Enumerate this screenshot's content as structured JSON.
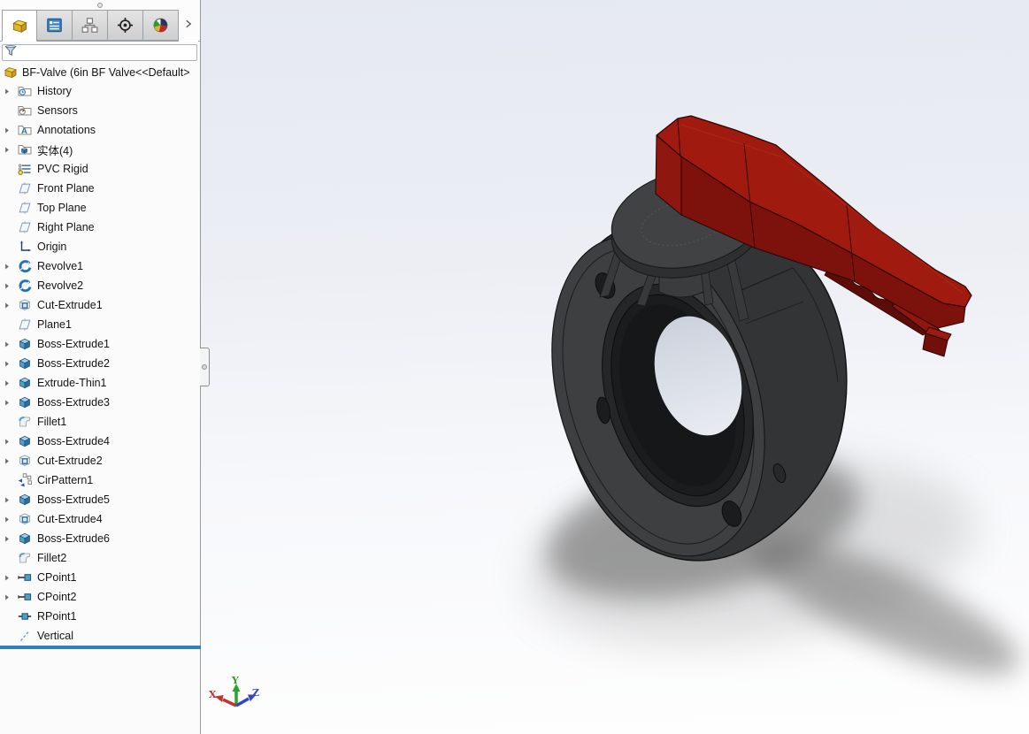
{
  "panel": {
    "tabs": [
      {
        "name": "featuremanager-design-tree",
        "icon": "part-icon",
        "active": true
      },
      {
        "name": "propertymanager",
        "icon": "property-manager-icon",
        "active": false
      },
      {
        "name": "configurationmanager",
        "icon": "configuration-manager-icon",
        "active": false
      },
      {
        "name": "dimxpertmanager",
        "icon": "dimxpert-manager-icon",
        "active": false
      },
      {
        "name": "displaymanager",
        "icon": "display-manager-icon",
        "active": false
      }
    ],
    "tab_overflow_icon": "chevron-right-icon",
    "filter": {
      "value": "",
      "placeholder": "",
      "icon": "filter-funnel-icon"
    },
    "tree": {
      "root": {
        "label": "BF-Valve (6in BF Valve<<Default>",
        "icon": "part-icon"
      },
      "items": [
        {
          "label": "History",
          "icon": "history-folder-icon",
          "expandable": true
        },
        {
          "label": "Sensors",
          "icon": "sensors-folder-icon",
          "expandable": false
        },
        {
          "label": "Annotations",
          "icon": "annotations-folder-icon",
          "expandable": true
        },
        {
          "label": "实体(4)",
          "icon": "solids-folder-icon",
          "expandable": true
        },
        {
          "label": "PVC Rigid",
          "icon": "material-icon",
          "expandable": false
        },
        {
          "label": "Front Plane",
          "icon": "plane-icon",
          "expandable": false
        },
        {
          "label": "Top Plane",
          "icon": "plane-icon",
          "expandable": false
        },
        {
          "label": "Right Plane",
          "icon": "plane-icon",
          "expandable": false
        },
        {
          "label": "Origin",
          "icon": "origin-icon",
          "expandable": false
        },
        {
          "label": "Revolve1",
          "icon": "revolve-icon",
          "expandable": true
        },
        {
          "label": "Revolve2",
          "icon": "revolve-icon",
          "expandable": true
        },
        {
          "label": "Cut-Extrude1",
          "icon": "cut-extrude-icon",
          "expandable": true
        },
        {
          "label": "Plane1",
          "icon": "plane-icon",
          "expandable": false
        },
        {
          "label": "Boss-Extrude1",
          "icon": "boss-extrude-icon",
          "expandable": true
        },
        {
          "label": "Boss-Extrude2",
          "icon": "boss-extrude-icon",
          "expandable": true
        },
        {
          "label": "Extrude-Thin1",
          "icon": "boss-extrude-icon",
          "expandable": true
        },
        {
          "label": "Boss-Extrude3",
          "icon": "boss-extrude-icon",
          "expandable": true
        },
        {
          "label": "Fillet1",
          "icon": "fillet-icon",
          "expandable": false
        },
        {
          "label": "Boss-Extrude4",
          "icon": "boss-extrude-icon",
          "expandable": true
        },
        {
          "label": "Cut-Extrude2",
          "icon": "cut-extrude-icon",
          "expandable": true
        },
        {
          "label": "CirPattern1",
          "icon": "cirpattern-icon",
          "expandable": false
        },
        {
          "label": "Boss-Extrude5",
          "icon": "boss-extrude-icon",
          "expandable": true
        },
        {
          "label": "Cut-Extrude4",
          "icon": "cut-extrude-icon",
          "expandable": true
        },
        {
          "label": "Boss-Extrude6",
          "icon": "boss-extrude-icon",
          "expandable": true
        },
        {
          "label": "Fillet2",
          "icon": "fillet-icon",
          "expandable": false
        },
        {
          "label": "CPoint1",
          "icon": "cpoint-icon",
          "expandable": true
        },
        {
          "label": "CPoint2",
          "icon": "cpoint-icon",
          "expandable": true
        },
        {
          "label": "RPoint1",
          "icon": "rpoint-icon",
          "expandable": false
        },
        {
          "label": "Vertical",
          "icon": "vertical-icon",
          "expandable": false
        }
      ]
    },
    "rollback_bar_color": "#2f80c0"
  },
  "viewport": {
    "model": {
      "name": "butterfly-valve",
      "body_color": "#3d3f41",
      "handle_color": "#a01a0f"
    },
    "triad": {
      "x_label": "X",
      "y_label": "Y",
      "z_label": "Z",
      "x_color": "#c03434",
      "y_color": "#27a527",
      "z_color": "#3344cc"
    }
  }
}
